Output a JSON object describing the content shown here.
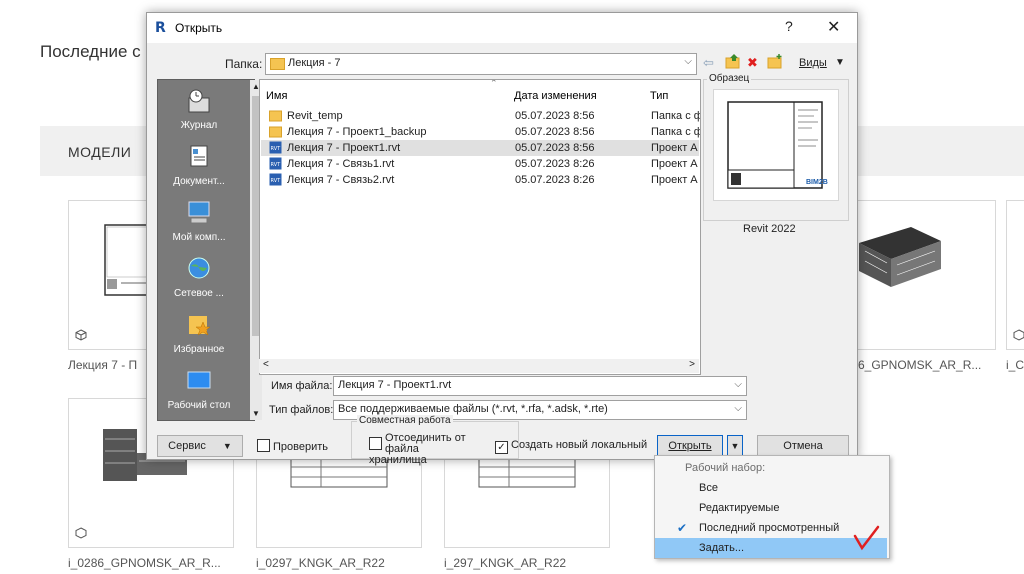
{
  "background": {
    "section_title": "Последние с",
    "band_label": "МОДЕЛИ",
    "thumbnails": [
      {
        "label": "Лекция 7 - П"
      },
      {
        "label": "6_GPNOMSK_AR_R..."
      },
      {
        "label": "i_C"
      },
      {
        "label": "i_0286_GPNOMSK_AR_R..."
      },
      {
        "label": "i_0297_KNGK_AR_R22"
      },
      {
        "label": "i_297_KNGK_AR_R22"
      }
    ]
  },
  "dialog": {
    "title": "Открыть",
    "logo": "R",
    "help": "?",
    "close": "✕",
    "folder_label": "Папка:",
    "folder_value": "Лекция - 7",
    "views_label": "Виды",
    "places": [
      {
        "label": "Журнал",
        "icon": "history-icon"
      },
      {
        "label": "Документ...",
        "icon": "documents-icon"
      },
      {
        "label": "Мой комп...",
        "icon": "computer-icon"
      },
      {
        "label": "Сетевое ...",
        "icon": "network-icon"
      },
      {
        "label": "Избранное",
        "icon": "favorites-icon"
      },
      {
        "label": "Рабочий стол",
        "icon": "desktop-icon"
      }
    ],
    "columns": {
      "name": "Имя",
      "date": "Дата изменения",
      "type": "Тип"
    },
    "files": [
      {
        "name": "Revit_temp",
        "date": "05.07.2023 8:56",
        "type": "Папка с ф",
        "kind": "folder"
      },
      {
        "name": "Лекция 7 - Проект1_backup",
        "date": "05.07.2023 8:56",
        "type": "Папка с ф",
        "kind": "folder"
      },
      {
        "name": "Лекция 7 - Проект1.rvt",
        "date": "05.07.2023 8:56",
        "type": "Проект А",
        "kind": "rvt"
      },
      {
        "name": "Лекция 7 - Связь1.rvt",
        "date": "05.07.2023 8:26",
        "type": "Проект А",
        "kind": "rvt"
      },
      {
        "name": "Лекция 7 - Связь2.rvt",
        "date": "05.07.2023 8:26",
        "type": "Проект А",
        "kind": "rvt"
      }
    ],
    "preview_label": "Образец",
    "preview_logo": "BIM2B",
    "version": "Revit 2022",
    "filename_label": "Имя файла:",
    "filename_value": "Лекция 7 - Проект1.rvt",
    "filetype_label": "Тип файлов:",
    "filetype_value": "Все поддерживаемые файлы  (*.rvt, *.rfa, *.adsk, *.rte)",
    "service_label": "Сервис",
    "check_label": "Проверить",
    "collab_group": "Совместная работа",
    "detach_label": "Отсоединить от файла хранилища",
    "create_local_label": "Создать новый локальный",
    "open_label": "Открыть",
    "cancel_label": "Отмена"
  },
  "menu": {
    "header": "Рабочий набор:",
    "items": [
      {
        "label": "Все"
      },
      {
        "label": "Редактируемые"
      },
      {
        "label": "Последний просмотренный",
        "checked": true
      },
      {
        "label": "Задать...",
        "highlighted": true
      }
    ]
  },
  "colors": {
    "highlight": "#90c8f6",
    "annotation": "#e02020"
  }
}
